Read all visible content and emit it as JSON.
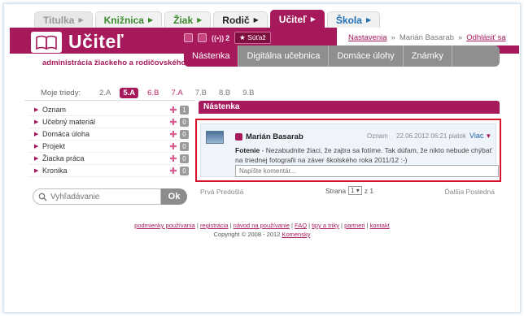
{
  "top_tabs": [
    {
      "label": "Titulka"
    },
    {
      "label": "Knižnica"
    },
    {
      "label": "Žiak"
    },
    {
      "label": "Rodič"
    },
    {
      "label": "Učiteľ"
    },
    {
      "label": "Škola"
    }
  ],
  "logo_text": "Učiteľ",
  "tagline": "administrácia žiackeho a rodičovského portálu",
  "header_icons": {
    "counter": "2",
    "sutaz_label": "Súťaž"
  },
  "user_bar": {
    "settings": "Nastavenia",
    "sep": "»",
    "user_name": "Marián Basarab",
    "logout": "Odhlásiť sa"
  },
  "main_nav": [
    "Nástenka",
    "Digitálna učebnica",
    "Domáce úlohy",
    "Známky"
  ],
  "classes": {
    "label": "Moje triedy:",
    "items": [
      "2.A",
      "5.A",
      "6.B",
      "7.A",
      "7.B",
      "8.B",
      "9.B"
    ],
    "selected": "5.A"
  },
  "left_menu": [
    {
      "label": "Oznam",
      "count": "1"
    },
    {
      "label": "Učebný materiál",
      "count": "0"
    },
    {
      "label": "Domáca úloha",
      "count": "0"
    },
    {
      "label": "Projekt",
      "count": "0"
    },
    {
      "label": "Žiacka práca",
      "count": "0"
    },
    {
      "label": "Kronika",
      "count": "0"
    }
  ],
  "search": {
    "placeholder": "Vyhľadávanie",
    "button": "Ok"
  },
  "board": {
    "title": "Nástenka",
    "post": {
      "author": "Marián Basarab",
      "type": "Oznam",
      "date": "22.06.2012 06:21 piatok",
      "more": "Viac",
      "lead": "Fotenie",
      "text": " - Nezabudnite žiaci, že zajtra sa fotíme. Tak dúfam, že nikto nebude chýbať na triednej fotografii na záver školského roka 2011/12 :-)",
      "comment_placeholder": "Napíšte komentár..."
    },
    "pager": {
      "first": "Prvá Predošlá",
      "page_label": "Strana",
      "page": "1",
      "of": "z 1",
      "last": "Ďalšia Posledná"
    }
  },
  "footer": {
    "links": [
      "podmienky používania",
      "registrácia",
      "návod na používanie",
      "FAQ",
      "tipy a triky",
      "partneri",
      "kontakt"
    ],
    "copyright_prefix": "Copyright © 2008 - 2012 ",
    "copyright_link": "Komensky"
  },
  "colors": {
    "brand": "#a6195b",
    "nav_gray": "#8f8f8f",
    "highlight": "#d6132a"
  }
}
